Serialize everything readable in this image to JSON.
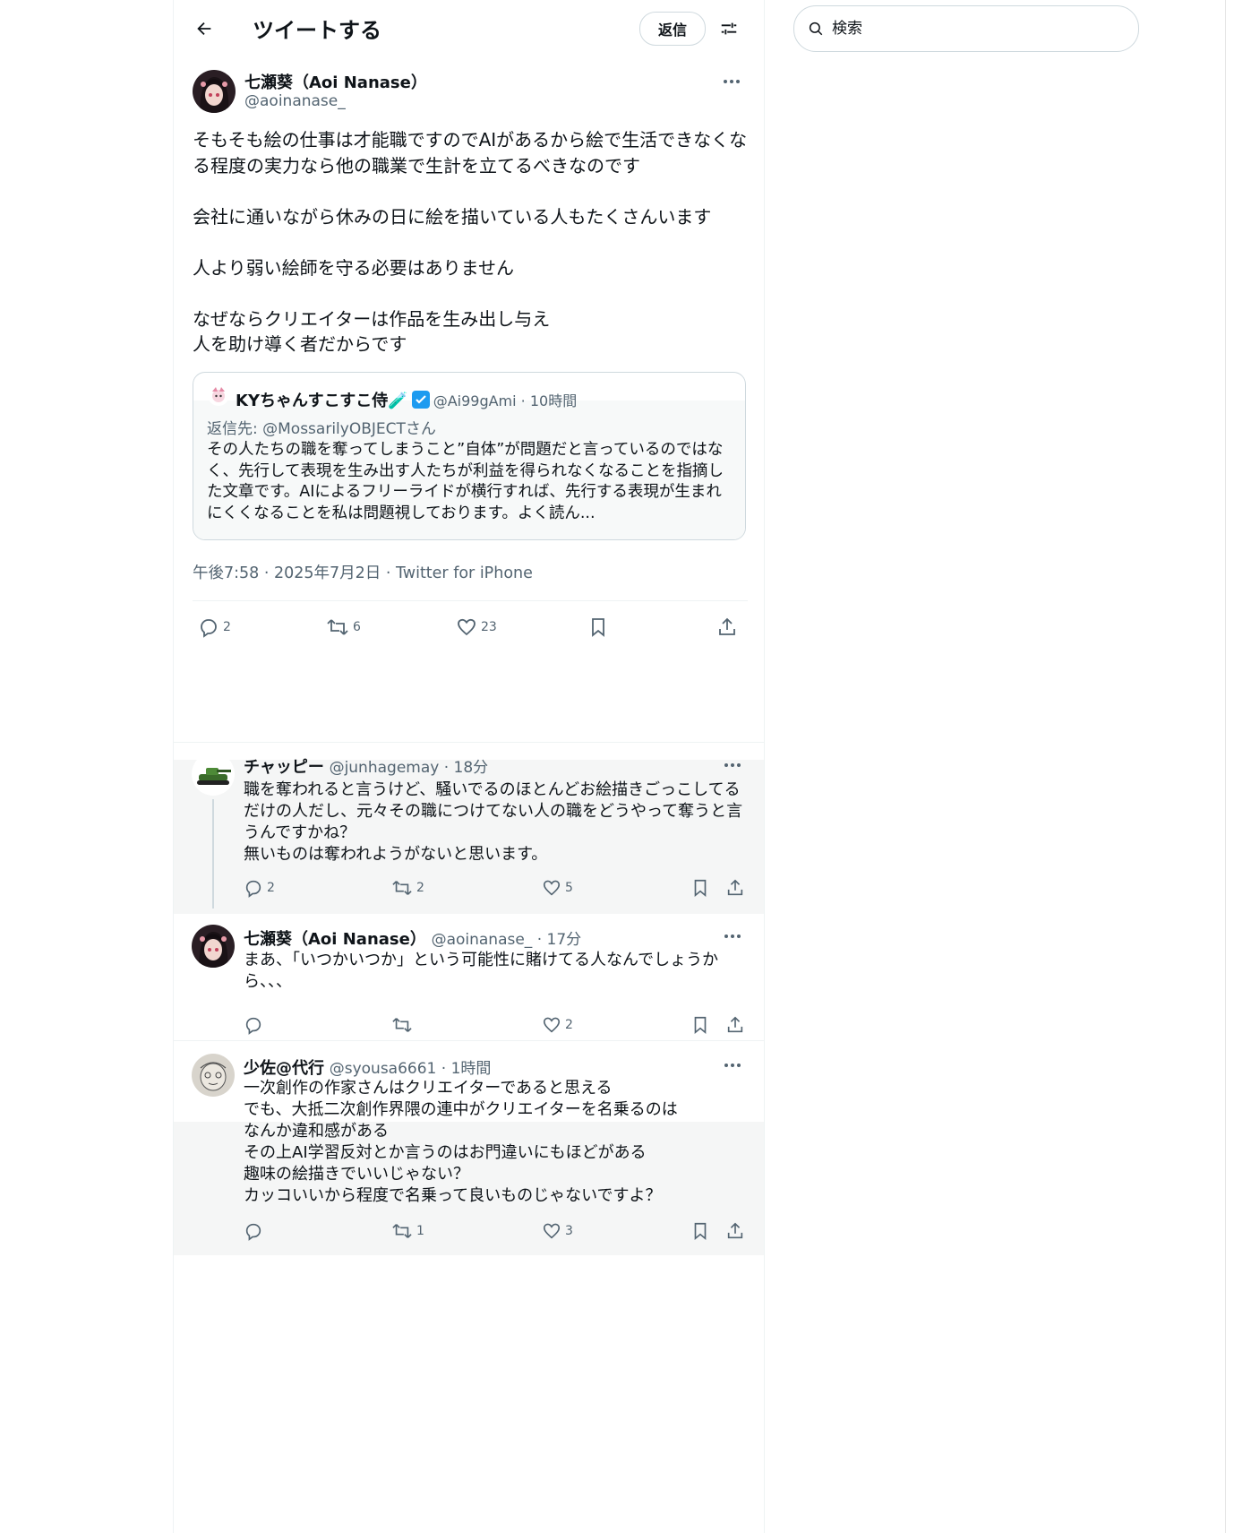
{
  "header": {
    "title": "ツイートする",
    "reply_button": "返信"
  },
  "search": {
    "placeholder": "検索"
  },
  "main_tweet": {
    "name": "七瀬葵（Aoi Nanase）",
    "handle": "@aoinanase_",
    "body": "そもそも絵の仕事は才能職ですのでAIがあるから絵で生活できなくなる程度の実力なら他の職業で生計を立てるべきなのです\n\n会社に通いながら休みの日に絵を描いている人もたくさんいます\n\n人より弱い絵師を守る必要はありません\n\nなぜならクリエイターは作品を生み出し与え\n人を助け導く者だからです",
    "timestamp": "午後7:58 · 2025年7月2日 · Twitter for iPhone",
    "replies": "2",
    "retweets": "6",
    "likes": "23"
  },
  "quote": {
    "name": "KYちゃんすこすこ侍🧪",
    "meta": "@Ai99gAmi · 10時間",
    "reply_to": "返信先: @MossarilyOBJECTさん",
    "body": "その人たちの職を奪ってしまうこと”自体”が問題だと言っているのではなく、先行して表現を生み出す人たちが利益を得られなくなることを指摘した文章です。AIによるフリーライドが横行すれば、先行する表現が生まれにくくなることを私は問題視しております。よく読ん..."
  },
  "replies": [
    {
      "name": "チャッピー",
      "meta": "@junhagemay · 18分",
      "body": "職を奪われると言うけど、騒いでるのほとんどお絵描きごっこしてるだけの人だし、元々その職につけてない人の職をどうやって奪うと言うんですかね？\n無いものは奪われようがないと思います。",
      "replies": "2",
      "retweets": "2",
      "likes": "5"
    },
    {
      "name": "七瀬葵（Aoi Nanase）",
      "meta": "@aoinanase_ · 17分",
      "body": "まあ、「いつかいつか」という可能性に賭けてる人なんでしょうから、、、",
      "replies": "",
      "retweets": "",
      "likes": "2"
    },
    {
      "name": "少佐@代行",
      "meta": "@syousa6661 · 1時間",
      "body": "一次創作の作家さんはクリエイターであると思える\nでも、大抵二次創作界隈の連中がクリエイターを名乗るのは\nなんか違和感がある\nその上AI学習反対とか言うのはお門違いにもほどがある\n趣味の絵描きでいいじゃない？\nカッコいいから程度で名乗って良いものじゃないですよ？",
      "replies": "",
      "retweets": "1",
      "likes": "3"
    }
  ],
  "colors": {
    "text": "#0f1419",
    "secondary": "#536471",
    "border": "#cfd9de",
    "verified": "#1d9bf0"
  }
}
